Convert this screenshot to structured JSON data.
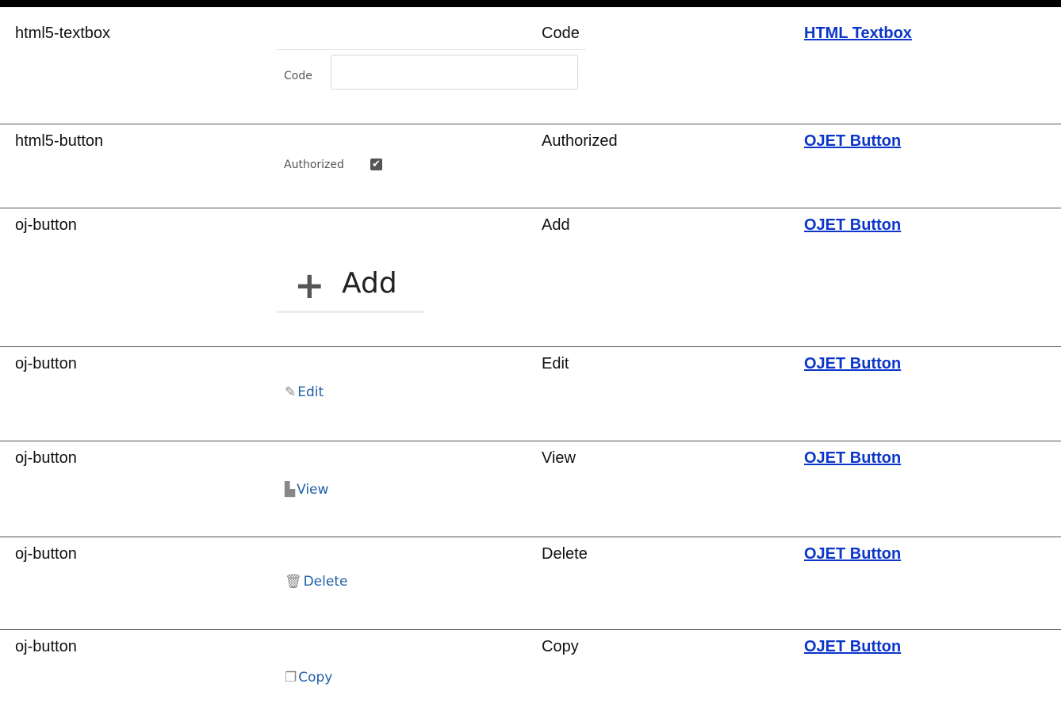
{
  "rows": [
    {
      "component": "html5-textbox",
      "label": "Code",
      "link": "HTML Textbox",
      "preview": {
        "field_label": "Code",
        "value": ""
      }
    },
    {
      "component": "html5-button",
      "label": "Authorized",
      "link": "OJET Button",
      "preview": {
        "field_label": "Authorized",
        "checked": true,
        "check_glyph": "✔"
      }
    },
    {
      "component": "oj-button",
      "label": "Add",
      "link": "OJET Button",
      "preview": {
        "icon": "plus-icon",
        "glyph": "+",
        "text": "Add"
      }
    },
    {
      "component": "oj-button",
      "label": "Edit",
      "link": "OJET Button",
      "preview": {
        "icon": "edit-icon",
        "glyph": "✎",
        "text": "Edit"
      }
    },
    {
      "component": "oj-button",
      "label": "View",
      "link": "OJET Button",
      "preview": {
        "icon": "document-icon",
        "glyph": "▙",
        "text": "View"
      }
    },
    {
      "component": "oj-button",
      "label": "Delete",
      "link": "OJET Button",
      "preview": {
        "icon": "trash-icon",
        "glyph": "🗑",
        "text": "Delete"
      }
    },
    {
      "component": "oj-button",
      "label": "Copy",
      "link": "OJET Button",
      "preview": {
        "icon": "copy-icon",
        "glyph": "❐",
        "text": "Copy"
      }
    }
  ],
  "colors": {
    "link": "#0b36c9",
    "button_text": "#1f5fa8",
    "icon": "#888888"
  }
}
